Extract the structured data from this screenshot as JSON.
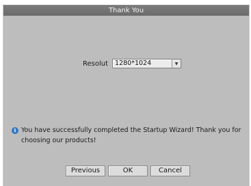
{
  "dialog": {
    "title": "Thank You",
    "resolution": {
      "label": "Resolut",
      "value": "1280*1024"
    },
    "message": "You have successfully completed the Startup Wizard! Thank you for choosing our products!",
    "icons": {
      "info": "info-icon",
      "dropdown": "chevron-down-icon"
    },
    "buttons": {
      "previous": "Previous",
      "ok": "OK",
      "cancel": "Cancel"
    }
  }
}
